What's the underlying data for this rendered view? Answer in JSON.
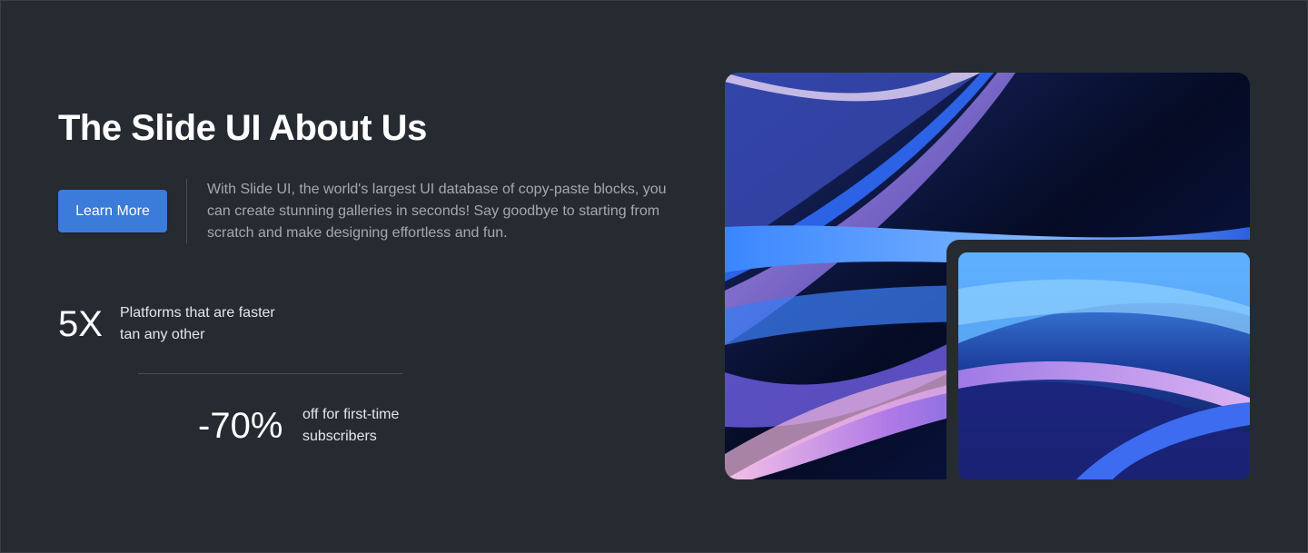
{
  "hero": {
    "title": "The Slide UI About Us",
    "cta_label": "Learn More",
    "description": "With Slide UI, the world's largest UI database of copy-paste blocks, you can create stunning galleries in seconds! Say goodbye to starting from scratch and make designing effortless and fun."
  },
  "stats": [
    {
      "value": "5X",
      "label": "Platforms that are faster tan any other"
    },
    {
      "value": "-70%",
      "label": "off for first-time subscribers"
    }
  ],
  "gallery": {
    "images": [
      "abstract-wave-image",
      "abstract-wave-image"
    ]
  },
  "colors": {
    "background": "#262b31",
    "accent": "#3b7bd9",
    "text_primary": "#ffffff",
    "text_muted": "#a3a9b1"
  }
}
